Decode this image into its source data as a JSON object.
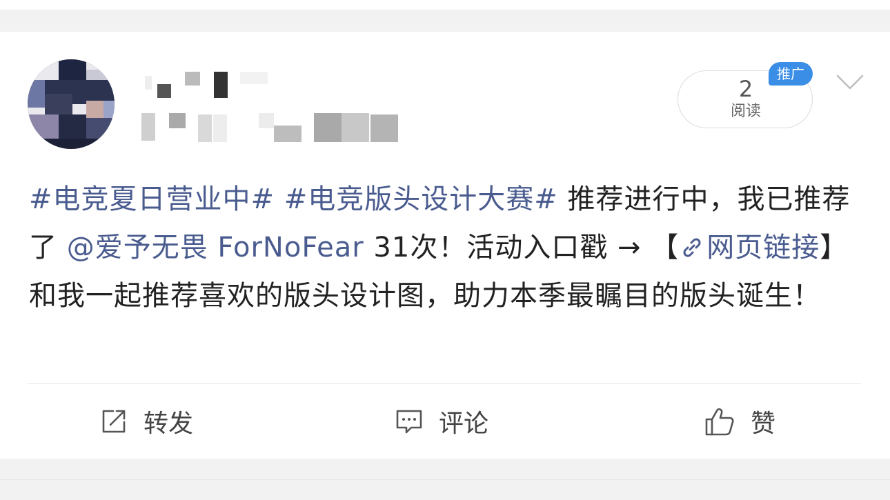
{
  "colors": {
    "link": "#4a5c8f",
    "text": "#222222",
    "badge": "#3a8ee6",
    "background": "#f2f2f2",
    "card": "#ffffff"
  },
  "post": {
    "read_count": "2",
    "read_label": "阅读",
    "promo_badge": "推广",
    "text": {
      "hashtag1": "#电竞夏日营业中#",
      "hashtag2": "#电竞版头设计大赛#",
      "part1": " 推荐进行中，我已推荐了 ",
      "mention": "@爱予无畏 ForNoFear",
      "part2": " 31次！活动入口戳 → 【",
      "web_link": "网页链接",
      "part3": "】和我一起推荐喜欢的版头设计图，助力本季最瞩目的版头诞生！"
    }
  },
  "actions": {
    "repost": {
      "label": "转发",
      "icon": "share-icon"
    },
    "comment": {
      "label": "评论",
      "icon": "comment-icon"
    },
    "like": {
      "label": "赞",
      "icon": "thumbs-up-icon"
    }
  }
}
